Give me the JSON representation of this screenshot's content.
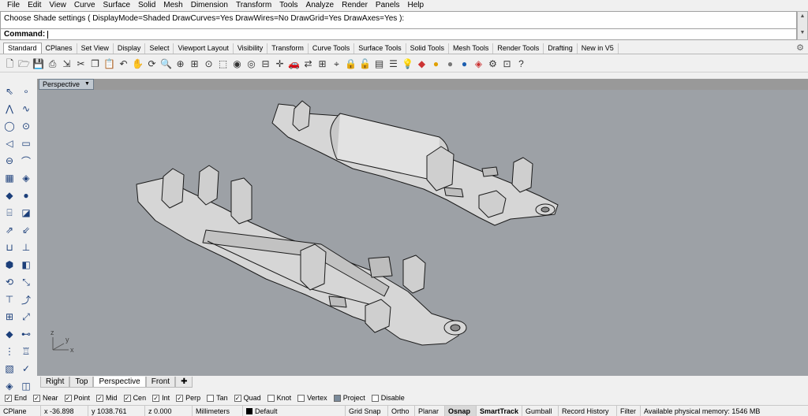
{
  "menu": [
    "File",
    "Edit",
    "View",
    "Curve",
    "Surface",
    "Solid",
    "Mesh",
    "Dimension",
    "Transform",
    "Tools",
    "Analyze",
    "Render",
    "Panels",
    "Help"
  ],
  "command": {
    "history": "Choose Shade settings ( DisplayMode=Shaded  DrawCurves=Yes  DrawWires=No  DrawGrid=Yes  DrawAxes=Yes ):",
    "prompt": "Command:"
  },
  "toolbar_tabs": [
    "Standard",
    "CPlanes",
    "Set View",
    "Display",
    "Select",
    "Viewport Layout",
    "Visibility",
    "Transform",
    "Curve Tools",
    "Surface Tools",
    "Solid Tools",
    "Mesh Tools",
    "Render Tools",
    "Drafting",
    "New in V5"
  ],
  "toolbar_icons": [
    "new-icon",
    "open-icon",
    "save-icon",
    "print-icon",
    "import-icon",
    "cut-icon",
    "copy-icon",
    "paste-icon",
    "undo-icon",
    "pan-icon",
    "rotate-view-icon",
    "zoom-icon",
    "zoom-window-icon",
    "zoom-extents-icon",
    "zoom-selected-icon",
    "select-all-icon",
    "show-icon",
    "hide-icon",
    "lock-icon",
    "unlock-icon",
    "layer-icon",
    "properties-icon",
    "light-icon",
    "render-icon",
    "color-icon",
    "material-icon",
    "sphere-render-icon",
    "options-icon",
    "help-icon"
  ],
  "viewport": {
    "active_label": "Perspective",
    "tabs": [
      "Right",
      "Top",
      "Perspective",
      "Front"
    ],
    "axis_labels": [
      "z",
      "y",
      "x"
    ]
  },
  "osnaps": [
    {
      "label": "End",
      "checked": true
    },
    {
      "label": "Near",
      "checked": true
    },
    {
      "label": "Point",
      "checked": true
    },
    {
      "label": "Mid",
      "checked": true
    },
    {
      "label": "Cen",
      "checked": true
    },
    {
      "label": "Int",
      "checked": true
    },
    {
      "label": "Perp",
      "checked": true
    },
    {
      "label": "Tan",
      "checked": false
    },
    {
      "label": "Quad",
      "checked": true
    },
    {
      "label": "Knot",
      "checked": false
    },
    {
      "label": "Vertex",
      "checked": false
    },
    {
      "label": "Project",
      "checked": true
    },
    {
      "label": "Disable",
      "checked": false
    }
  ],
  "status": {
    "cplane": "CPlane",
    "x": "x -36.898",
    "y": "y 1038.761",
    "z": "z 0.000",
    "units": "Millimeters",
    "layer": "Default",
    "grid_snap": "Grid Snap",
    "ortho": "Ortho",
    "planar": "Planar",
    "osnap": "Osnap",
    "smarttrack": "SmartTrack",
    "gumball": "Gumball",
    "record_history": "Record History",
    "filter": "Filter",
    "memory": "Available physical memory: 1546 MB"
  },
  "colors": {
    "viewport_bg": "#9da1a6",
    "part_fill": "#d6d6d6",
    "part_stroke": "#1a1a1a"
  }
}
